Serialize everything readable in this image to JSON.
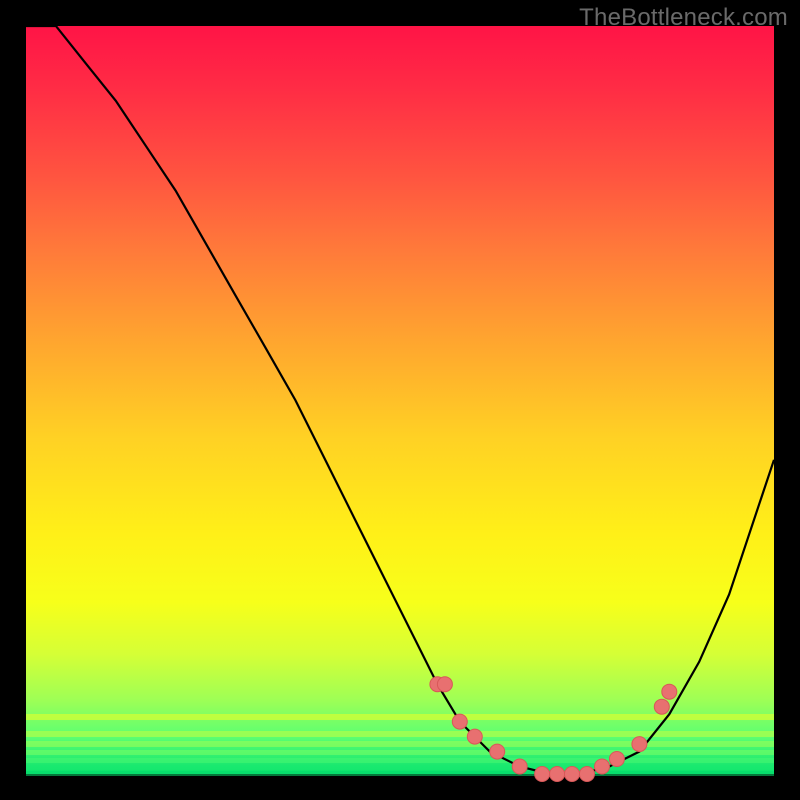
{
  "watermark": "TheBottleneck.com",
  "colors": {
    "frame": "#000000",
    "gradient_top": "#ff1446",
    "gradient_bottom": "#08e26e",
    "curve": "#000000",
    "marker_fill": "#e87070",
    "marker_stroke": "#d85858"
  },
  "chart_data": {
    "type": "line",
    "title": "",
    "xlabel": "",
    "ylabel": "",
    "xlim": [
      0,
      100
    ],
    "ylim": [
      0,
      100
    ],
    "grid": false,
    "curve": {
      "x": [
        0,
        4,
        8,
        12,
        16,
        20,
        24,
        28,
        32,
        36,
        40,
        44,
        48,
        52,
        55,
        58,
        62,
        66,
        70,
        74,
        78,
        82,
        86,
        90,
        94,
        98,
        100
      ],
      "values": [
        100,
        100,
        95,
        90,
        84,
        78,
        71,
        64,
        57,
        50,
        42,
        34,
        26,
        18,
        12,
        7,
        3,
        1,
        0,
        0,
        1,
        3,
        8,
        15,
        24,
        36,
        42
      ]
    },
    "markers": {
      "x": [
        55,
        56,
        58,
        60,
        63,
        66,
        69,
        71,
        73,
        75,
        77,
        79,
        82,
        85,
        86
      ],
      "values": [
        12,
        12,
        7,
        5,
        3,
        1,
        0,
        0,
        0,
        0,
        1,
        2,
        4,
        9,
        11
      ]
    },
    "bottom_bands": [
      {
        "y": 8.0,
        "h": 0.8,
        "color": "#f2ff22"
      },
      {
        "y": 5.8,
        "h": 0.8,
        "color": "#c6ff3e"
      },
      {
        "y": 4.4,
        "h": 0.8,
        "color": "#a3ff52"
      },
      {
        "y": 3.2,
        "h": 0.7,
        "color": "#7aff64"
      },
      {
        "y": 2.2,
        "h": 0.7,
        "color": "#49f871"
      },
      {
        "y": 1.2,
        "h": 0.7,
        "color": "#1aea70"
      },
      {
        "y": 0.4,
        "h": 0.7,
        "color": "#06d86c"
      }
    ]
  }
}
